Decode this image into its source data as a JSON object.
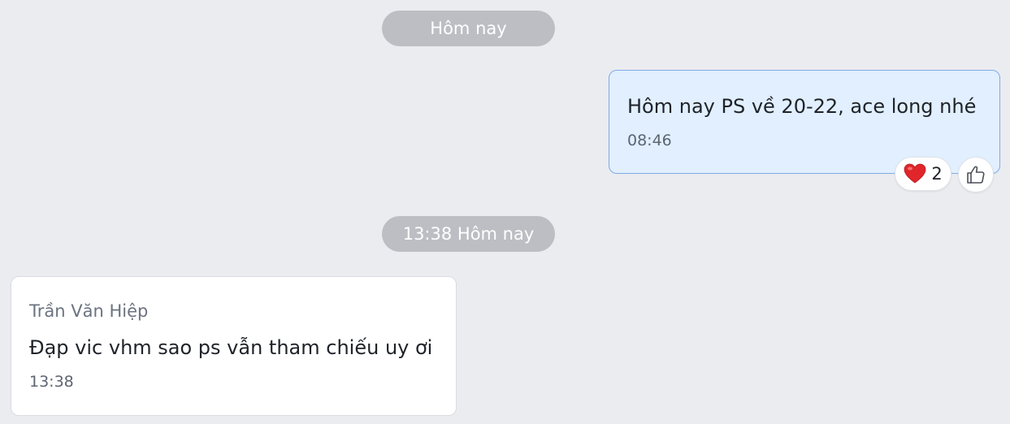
{
  "date_separators": [
    {
      "label": "Hôm nay"
    },
    {
      "label": "13:38 Hôm nay"
    }
  ],
  "outgoing_message": {
    "text": "Hôm nay PS về 20-22, ace long nhé",
    "time": "08:46",
    "reactions": [
      {
        "icon": "heart-icon",
        "count": "2",
        "color": "#e0262b"
      }
    ],
    "add_reaction_icon": "thumbs-up-icon"
  },
  "incoming_message": {
    "sender": "Trần Văn Hiệp",
    "text": "Đạp vic vhm sao ps vẫn tham chiếu uy ơi",
    "time": "13:38"
  },
  "colors": {
    "background": "#ebecf0",
    "outgoing_bubble": "#e1efff",
    "outgoing_border": "#7fabe6",
    "date_pill": "#bcbec3"
  }
}
